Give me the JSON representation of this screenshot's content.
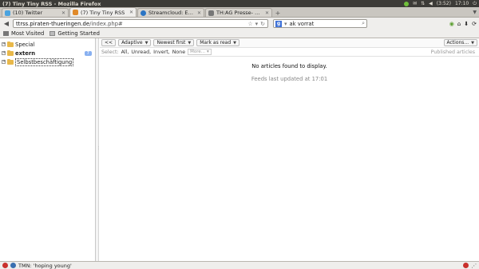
{
  "window": {
    "title": "(7) Tiny Tiny RSS - Mozilla Firefox"
  },
  "tray": {
    "battery": "(3:52)",
    "time": "17:10"
  },
  "tabs": [
    {
      "label": "(10) Twitter",
      "color": "#4aa3df"
    },
    {
      "label": "(7) Tiny Tiny RSS",
      "color": "#e08a2a"
    },
    {
      "label": "Streamcloud: Easy...",
      "color": "#2a74c4"
    },
    {
      "label": "TH:AG Presse- und...",
      "color": "#777777"
    }
  ],
  "nav": {
    "url_domain": "ttrss.piraten-thueringen.de",
    "url_path": "/index.php#",
    "search_value": "ak vorrat",
    "search_engine_glyph": "g"
  },
  "bookmarks": [
    {
      "label": "Most Visited"
    },
    {
      "label": "Getting Started"
    }
  ],
  "feeds": [
    {
      "label": "Special",
      "counter": ""
    },
    {
      "label": "extern",
      "counter": "7"
    },
    {
      "label": "Selbstbeschäftigung",
      "counter": ""
    }
  ],
  "headlines_toolbar": {
    "collapse": "<<",
    "view_mode": "Adaptive",
    "order": "Newest first",
    "mark_read": "Mark as read",
    "actions": "Actions..."
  },
  "select_bar": {
    "label": "Select:",
    "all": "All,",
    "unread": "Unread,",
    "invert": "Invert,",
    "none": "None",
    "more": "More...",
    "published": "Published articles"
  },
  "headlines": {
    "empty_message": "No articles found to display.",
    "updated": "Feeds last updated at 17:01"
  },
  "statusbar": {
    "text": "TMN: 'hoping young'"
  },
  "colors": {
    "tray_green": "#6fbf3a",
    "folder": "#e8b84a",
    "counter": "#88b0f0",
    "addon_red": "#c9302c"
  }
}
